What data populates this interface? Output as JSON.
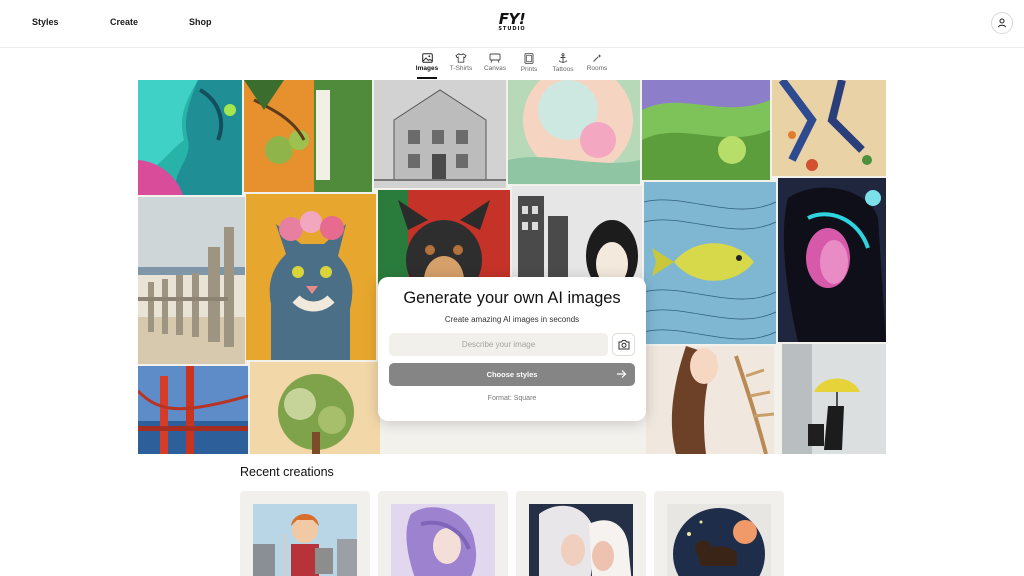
{
  "header": {
    "nav": [
      {
        "label": "Styles"
      },
      {
        "label": "Create"
      },
      {
        "label": "Shop"
      }
    ],
    "logo": {
      "main": "FY!",
      "sub": "STUDIO"
    },
    "user_icon": "user-icon"
  },
  "tabs": [
    {
      "label": "Images",
      "icon": "image-icon",
      "active": true
    },
    {
      "label": "T-Shirts",
      "icon": "tshirt-icon",
      "active": false
    },
    {
      "label": "Canvas",
      "icon": "canvas-icon",
      "active": false
    },
    {
      "label": "Prints",
      "icon": "prints-icon",
      "active": false
    },
    {
      "label": "Tattoos",
      "icon": "tattoo-icon",
      "active": false
    },
    {
      "label": "Rooms",
      "icon": "rooms-icon",
      "active": false
    }
  ],
  "generator": {
    "title": "Generate your own AI images",
    "subtitle": "Create amazing AI images in seconds",
    "input_placeholder": "Describe your image",
    "camera_icon": "camera-icon",
    "button_label": "Choose styles",
    "format_label": "Format: Square"
  },
  "recent": {
    "title": "Recent creations"
  },
  "colors": {
    "button_bg": "#858585",
    "input_bg": "#f2f0ea",
    "card_bg": "#f1f0ed"
  }
}
